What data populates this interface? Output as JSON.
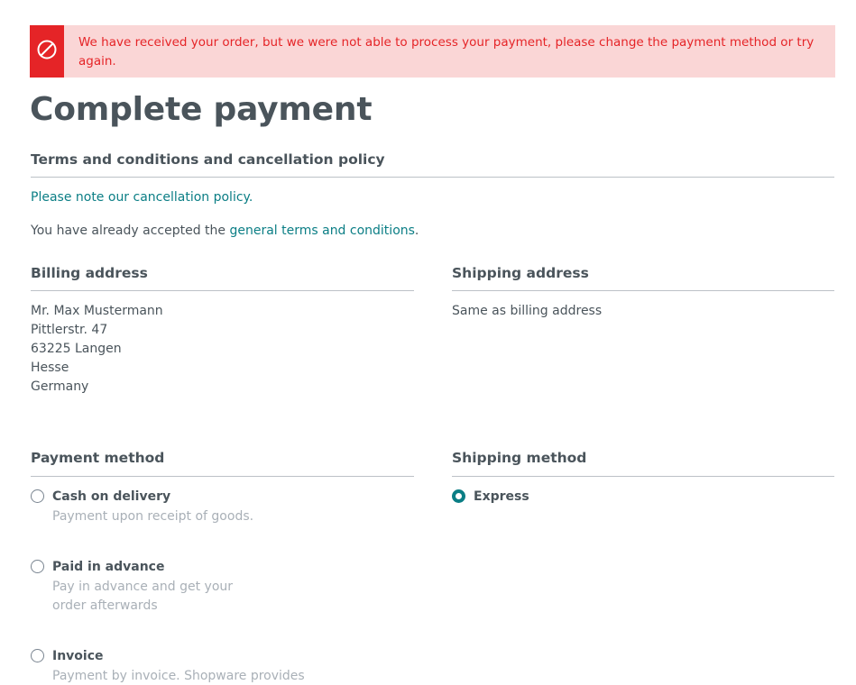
{
  "alert": {
    "message": "We have received your order, but we were not able to process your payment, please change the payment method or try again.",
    "icon": "blocked-icon",
    "color": "#e52427"
  },
  "headline": "Complete payment",
  "terms": {
    "title": "Terms and conditions and cancellation policy",
    "cancellation_link": "Please note our cancellation policy.",
    "accepted_prefix": "You have already accepted the ",
    "accepted_link": "general terms and conditions",
    "accepted_suffix": "."
  },
  "billing": {
    "title": "Billing address",
    "lines": [
      "Mr. Max Mustermann",
      "Pittlerstr. 47",
      "63225 Langen",
      "Hesse",
      "Germany"
    ]
  },
  "shipping_address": {
    "title": "Shipping address",
    "text": "Same as billing address"
  },
  "payment": {
    "title": "Payment method",
    "options": [
      {
        "label": "Cash on delivery",
        "description": "Payment upon receipt of goods.",
        "selected": false
      },
      {
        "label": "Paid in advance",
        "description": "Pay in advance and get your order afterwards",
        "selected": false
      },
      {
        "label": "Invoice",
        "description": "Payment by invoice. Shopware provides",
        "selected": false
      }
    ]
  },
  "shipping_method": {
    "title": "Shipping method",
    "options": [
      {
        "label": "Express",
        "selected": true
      }
    ]
  },
  "colors": {
    "accent": "#0b7e85",
    "text": "#4a545b",
    "muted": "#a9b0b7",
    "alert_bg": "#fad6d6"
  }
}
